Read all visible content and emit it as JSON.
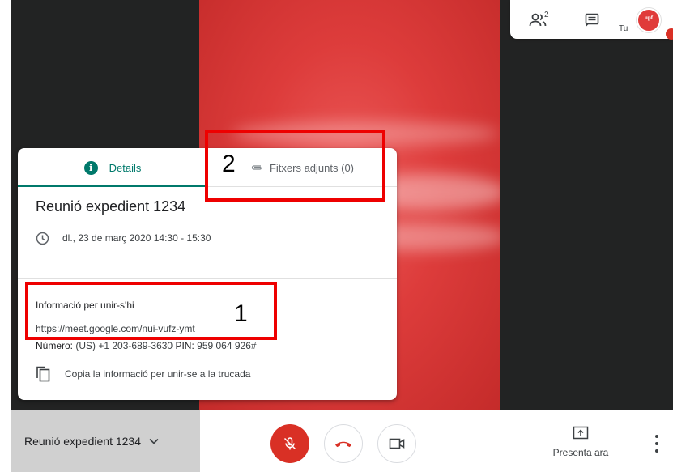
{
  "colors": {
    "accent": "#00796b",
    "danger": "#d93025",
    "annotation": "#ee0000",
    "stage_bg": "#222323"
  },
  "top_bar": {
    "participants_icon": "people-icon",
    "participants_count": "2",
    "chat_icon": "chat-icon",
    "self_label": "Tu",
    "self_avatar_text": "upf"
  },
  "details_panel": {
    "tabs": [
      {
        "label": "Details",
        "icon": "info-icon"
      },
      {
        "label": "Fitxers adjunts (0)",
        "icon": "paperclip-icon"
      }
    ],
    "info_icon_glyph": "i",
    "meeting_title": "Reunió expedient 1234",
    "datetime": "dl., 23 de març 2020 14:30 - 15:30",
    "join_heading": "Informació per unir-s'hi",
    "join_url": "https://meet.google.com/nui-vufz-ymt",
    "phone_label": "Número:",
    "phone_value": "(US) +1 203-689-3630",
    "pin_label": "PIN:",
    "pin_value": "959 064 926#",
    "copy_label": "Copia la informació per unir-se a la trucada"
  },
  "annotations": [
    {
      "number": "2",
      "target": "tab-attachments"
    },
    {
      "number": "1",
      "target": "join-info"
    }
  ],
  "bottom_bar": {
    "meeting_name": "Reunió expedient 1234",
    "mic_icon": "mic-off-icon",
    "hangup_icon": "hangup-icon",
    "camera_icon": "camera-icon",
    "present_label": "Presenta ara",
    "more_icon": "more-vert-icon"
  }
}
